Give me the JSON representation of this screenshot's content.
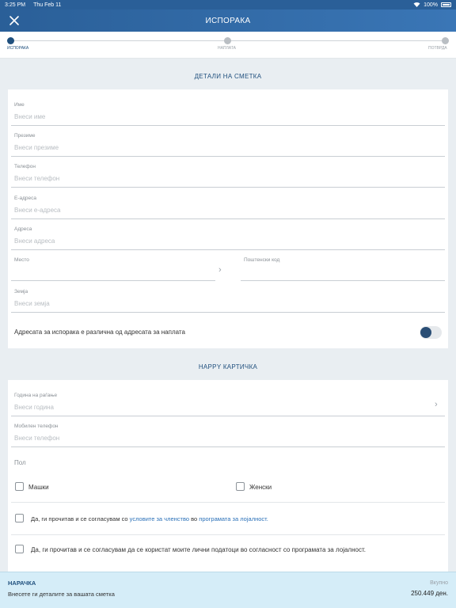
{
  "status_bar": {
    "time": "3:25 PM",
    "date": "Thu Feb 11",
    "battery": "100%"
  },
  "header": {
    "title": "ИСПОРАКА"
  },
  "stepper": {
    "steps": [
      "ИСПОРАКА",
      "НАПЛАТА",
      "ПОТВРДА"
    ],
    "active_index": 0
  },
  "account": {
    "section_title": "ДЕТАЛИ НА СМЕТКА",
    "fields": {
      "name": {
        "label": "Име",
        "placeholder": "Внеси име"
      },
      "surname": {
        "label": "Презиме",
        "placeholder": "Внеси презиме"
      },
      "phone": {
        "label": "Телефон",
        "placeholder": "Внеси телефон"
      },
      "email": {
        "label": "Е-адреса",
        "placeholder": "Внеси е-адреса"
      },
      "address": {
        "label": "Адреса",
        "placeholder": "Внеси адреса"
      },
      "city": {
        "label": "Место"
      },
      "postal": {
        "label": "Поштенски код"
      },
      "country": {
        "label": "Земја",
        "placeholder": "Внеси земја"
      }
    },
    "different_address_label": "Адресата за испорака е различна од адресата за наплата"
  },
  "happy": {
    "section_title": "HAPPY КАРТИЧКА",
    "birth_year": {
      "label": "Година на раѓање",
      "placeholder": "Внеси година"
    },
    "mobile": {
      "label": "Мобилен телефон",
      "placeholder": "Внеси телефон"
    },
    "gender_label": "Пол",
    "male": "Машки",
    "female": "Женски",
    "terms_prefix": "Да, ги прочитав и се согласувам со ",
    "terms_link1": "условите за членство",
    "terms_mid": " во ",
    "terms_link2": "програмата за лојалност",
    "terms_suffix": ".",
    "consent": "Да, ги прочитав и се согласувам да се користат моите лични податоци во согласност со програмата за лојалност."
  },
  "footer": {
    "title": "НАРАЧКА",
    "subtitle": "Внесете ги деталите за вашата сметка",
    "total_label": "Вкупно",
    "total_value": "250.449 ден."
  },
  "colors": {
    "primary": "#1f4f7d",
    "header": "#2a5f98",
    "link": "#2a70b8",
    "footer_bg": "#d5edf8"
  }
}
